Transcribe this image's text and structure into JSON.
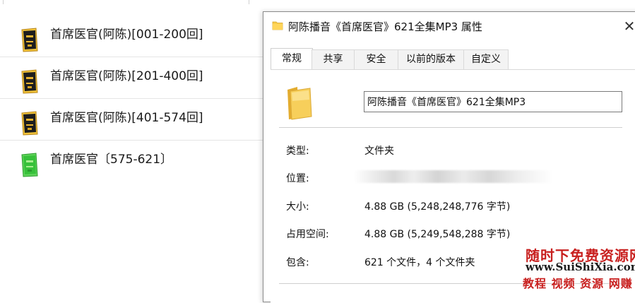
{
  "explorer": {
    "files": [
      {
        "name": "首席医官(阿陈)[001-200回]",
        "icon": "book-folder-icon",
        "color": "#1b1b1b"
      },
      {
        "name": "首席医官(阿陈)[201-400回]",
        "icon": "book-folder-icon",
        "color": "#1b1b1b"
      },
      {
        "name": "首席医官(阿陈)[401-574回]",
        "icon": "book-folder-icon",
        "color": "#1b1b1b"
      },
      {
        "name": "首席医官〔575-621〕",
        "icon": "green-folder-icon",
        "color": "#37c13a"
      }
    ]
  },
  "dialog": {
    "title": "阿陈播音《首席医官》621全集MP3 属性",
    "close_label": "✕",
    "tabs": [
      {
        "label": "常规",
        "active": true
      },
      {
        "label": "共享",
        "active": false
      },
      {
        "label": "安全",
        "active": false
      },
      {
        "label": "以前的版本",
        "active": false
      },
      {
        "label": "自定义",
        "active": false
      }
    ],
    "folder_name": "阿陈播音《首席医官》621全集MP3",
    "properties": [
      {
        "label": "类型:",
        "value": "文件夹"
      },
      {
        "label": "位置:",
        "value": ""
      },
      {
        "label": "大小:",
        "value": "4.88 GB (5,248,248,776 字节)"
      },
      {
        "label": "占用空间:",
        "value": "4.88 GB (5,249,548,288 字节)"
      },
      {
        "label": "包含:",
        "value": "621 个文件，4 个文件夹"
      }
    ]
  },
  "watermark": {
    "line1": "随时下免费资源网",
    "line2": "www.SuiShiXia.com",
    "line3": "教程 视频 资源 网赚"
  },
  "colors": {
    "folder_yellow": "#f5c944",
    "folder_yellow_dark": "#e0a92a",
    "green_folder": "#37c13a",
    "watermark_red": "#c8201f"
  }
}
